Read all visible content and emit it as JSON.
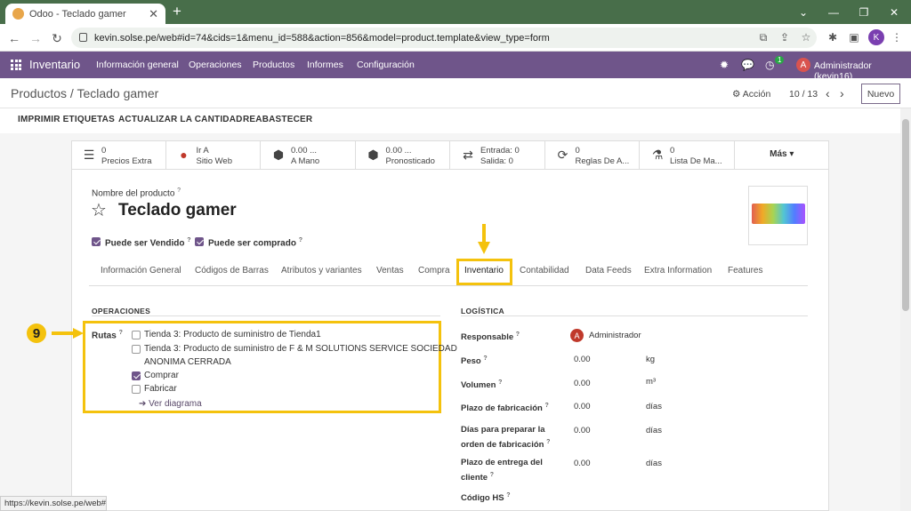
{
  "browser": {
    "tab_title": "Odoo - Teclado gamer",
    "url": "kevin.solse.pe/web#id=74&cids=1&menu_id=588&action=856&model=product.template&view_type=form",
    "profile_initial": "K",
    "status_url": "https://kevin.solse.pe/web#"
  },
  "navbar": {
    "app_name": "Inventario",
    "menus": [
      "Información general",
      "Operaciones",
      "Productos",
      "Informes",
      "Configuración"
    ],
    "activity_count": "1",
    "user_initial": "A",
    "user_name": "Administrador (kevin16)"
  },
  "breadcrumb": {
    "text": "Productos / Teclado gamer",
    "action_label": "Acción",
    "pager": "10 / 13",
    "new_label": "Nuevo"
  },
  "actions": [
    "IMPRIMIR ETIQUETAS",
    "ACTUALIZAR LA CANTIDAD",
    "REABASTECER"
  ],
  "smart_buttons": [
    {
      "icon": "list-icon",
      "line1": "0",
      "line2": "Precios Extra"
    },
    {
      "icon": "globe-icon",
      "line1": "Ir A",
      "line2": "Sitio Web"
    },
    {
      "icon": "cubes-icon",
      "line1": "0.00 ...",
      "line2": "A Mano"
    },
    {
      "icon": "cubes-icon",
      "line1": "0.00 ...",
      "line2": "Pronosticado"
    },
    {
      "icon": "exchange-icon",
      "line1": "Entrada:  0",
      "line2": "Salida:    0"
    },
    {
      "icon": "refresh-icon",
      "line1": "0",
      "line2": "Reglas De A..."
    },
    {
      "icon": "flask-icon",
      "line1": "0",
      "line2": "Lista De Ma..."
    }
  ],
  "more_label": "Más",
  "product": {
    "name_label": "Nombre del producto",
    "name": "Teclado gamer",
    "can_sell_label": "Puede ser Vendido",
    "can_buy_label": "Puede ser comprado"
  },
  "tabs": [
    "Información General",
    "Códigos de Barras",
    "Atributos y variantes",
    "Ventas",
    "Compra",
    "Inventario",
    "Contabilidad",
    "Data Feeds",
    "Extra Information",
    "Features"
  ],
  "operaciones": {
    "title": "OPERACIONES",
    "routes_label": "Rutas",
    "routes": [
      {
        "label": "Tienda 3: Producto de suministro de Tienda1",
        "checked": false
      },
      {
        "label": "Tienda 3: Producto de suministro de F & M SOLUTIONS SERVICE SOCIEDAD",
        "label2": "ANONIMA CERRADA",
        "checked": false
      },
      {
        "label": "Comprar",
        "checked": true
      },
      {
        "label": "Fabricar",
        "checked": false
      }
    ],
    "diagram_link": "Ver diagrama"
  },
  "logistica": {
    "title": "LOGÍSTICA",
    "responsable_label": "Responsable",
    "responsable_initial": "A",
    "responsable": "Administrador",
    "peso_label": "Peso",
    "peso": "0.00",
    "peso_unit": "kg",
    "volumen_label": "Volumen",
    "volumen": "0.00",
    "volumen_unit": "m³",
    "plazo_fab_label": "Plazo de fabricación",
    "plazo_fab": "0.00",
    "plazo_fab_unit": "días",
    "dias_prep_label1": "Días para preparar la",
    "dias_prep_label2": "orden de fabricación",
    "dias_prep": "0.00",
    "dias_prep_unit": "días",
    "plazo_ent_label1": "Plazo de entrega del",
    "plazo_ent_label2": "cliente",
    "plazo_ent": "0.00",
    "plazo_ent_unit": "días",
    "hs_label": "Código HS"
  },
  "annotation": {
    "step": "9",
    "color": "#f4c20d"
  },
  "tooltip_mark": "?"
}
